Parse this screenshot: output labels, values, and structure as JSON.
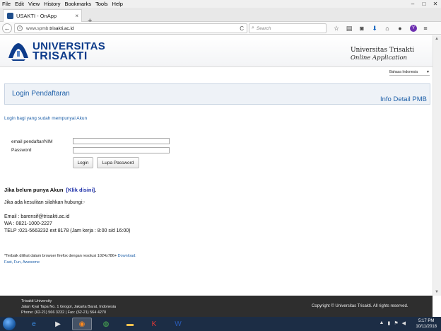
{
  "menu": [
    "File",
    "Edit",
    "View",
    "History",
    "Bookmarks",
    "Tools",
    "Help"
  ],
  "tab": {
    "title": "USAKTI - OnApp",
    "close": "×",
    "new_tab": "+"
  },
  "nav": {
    "back": "←",
    "url_prefix": "www.spmb.",
    "url_host": "trisakti.ac.id",
    "reload": "C",
    "search_placeholder": "Search"
  },
  "logo": {
    "line1": "UNIVERSITAS",
    "line2": "TRISAKTI"
  },
  "header_right": {
    "name": "Universitas Trisakti",
    "subtitle": "Online Application"
  },
  "language": {
    "selected": "Bahasa Indonesia"
  },
  "login": {
    "title": "Login Pendaftaran",
    "info_link": "Info Detail PMB",
    "subtitle": "Login bagi yang sudah mempunyai Akun",
    "email_label": "email pendaftar/NIM",
    "password_label": "Password",
    "email_value": "",
    "password_value": "",
    "login_button": "Login",
    "forgot_button": "Lupa Password"
  },
  "register": {
    "text": "Jika belum punya Akun",
    "link": "[Klik disini]",
    "suffix": "."
  },
  "help": {
    "line": "Jika ada kesulitan silahkan hubungi:-",
    "email": "Email : barensif@trisakti.ac.id",
    "wa": "WA : 0821-1000-2227",
    "telp": "TELP :021-5663232 ext 8178 (Jam kerja : 8:00 s/d 16:00)"
  },
  "footnote": {
    "text": "*Terbaik dilihat dalam browser firefox dengan resolusi 1024x786+",
    "download": "Download:",
    "tagline": "Fast, Fun, Awesome"
  },
  "footer": {
    "line1": "Trisakti University",
    "line2": "Jalan Kyai Tapa No. 1 Grogol, Jakarta Barat, Indonesia",
    "line3": "Phone: (62-21) 566 3232 | Fax: (62-21) 564 4270",
    "copyright": "Copyright © Universitas Trisakti. All rights reserved."
  },
  "taskbar": {
    "time": "5:17 PM",
    "date": "10/11/2018"
  },
  "colors": {
    "brand_blue": "#0d3b8a",
    "link_blue": "#1d5fa8",
    "panel_bg": "#eef2f7",
    "footer_bg": "#2e2e2e",
    "taskbar_bg": "#1c2d45"
  }
}
